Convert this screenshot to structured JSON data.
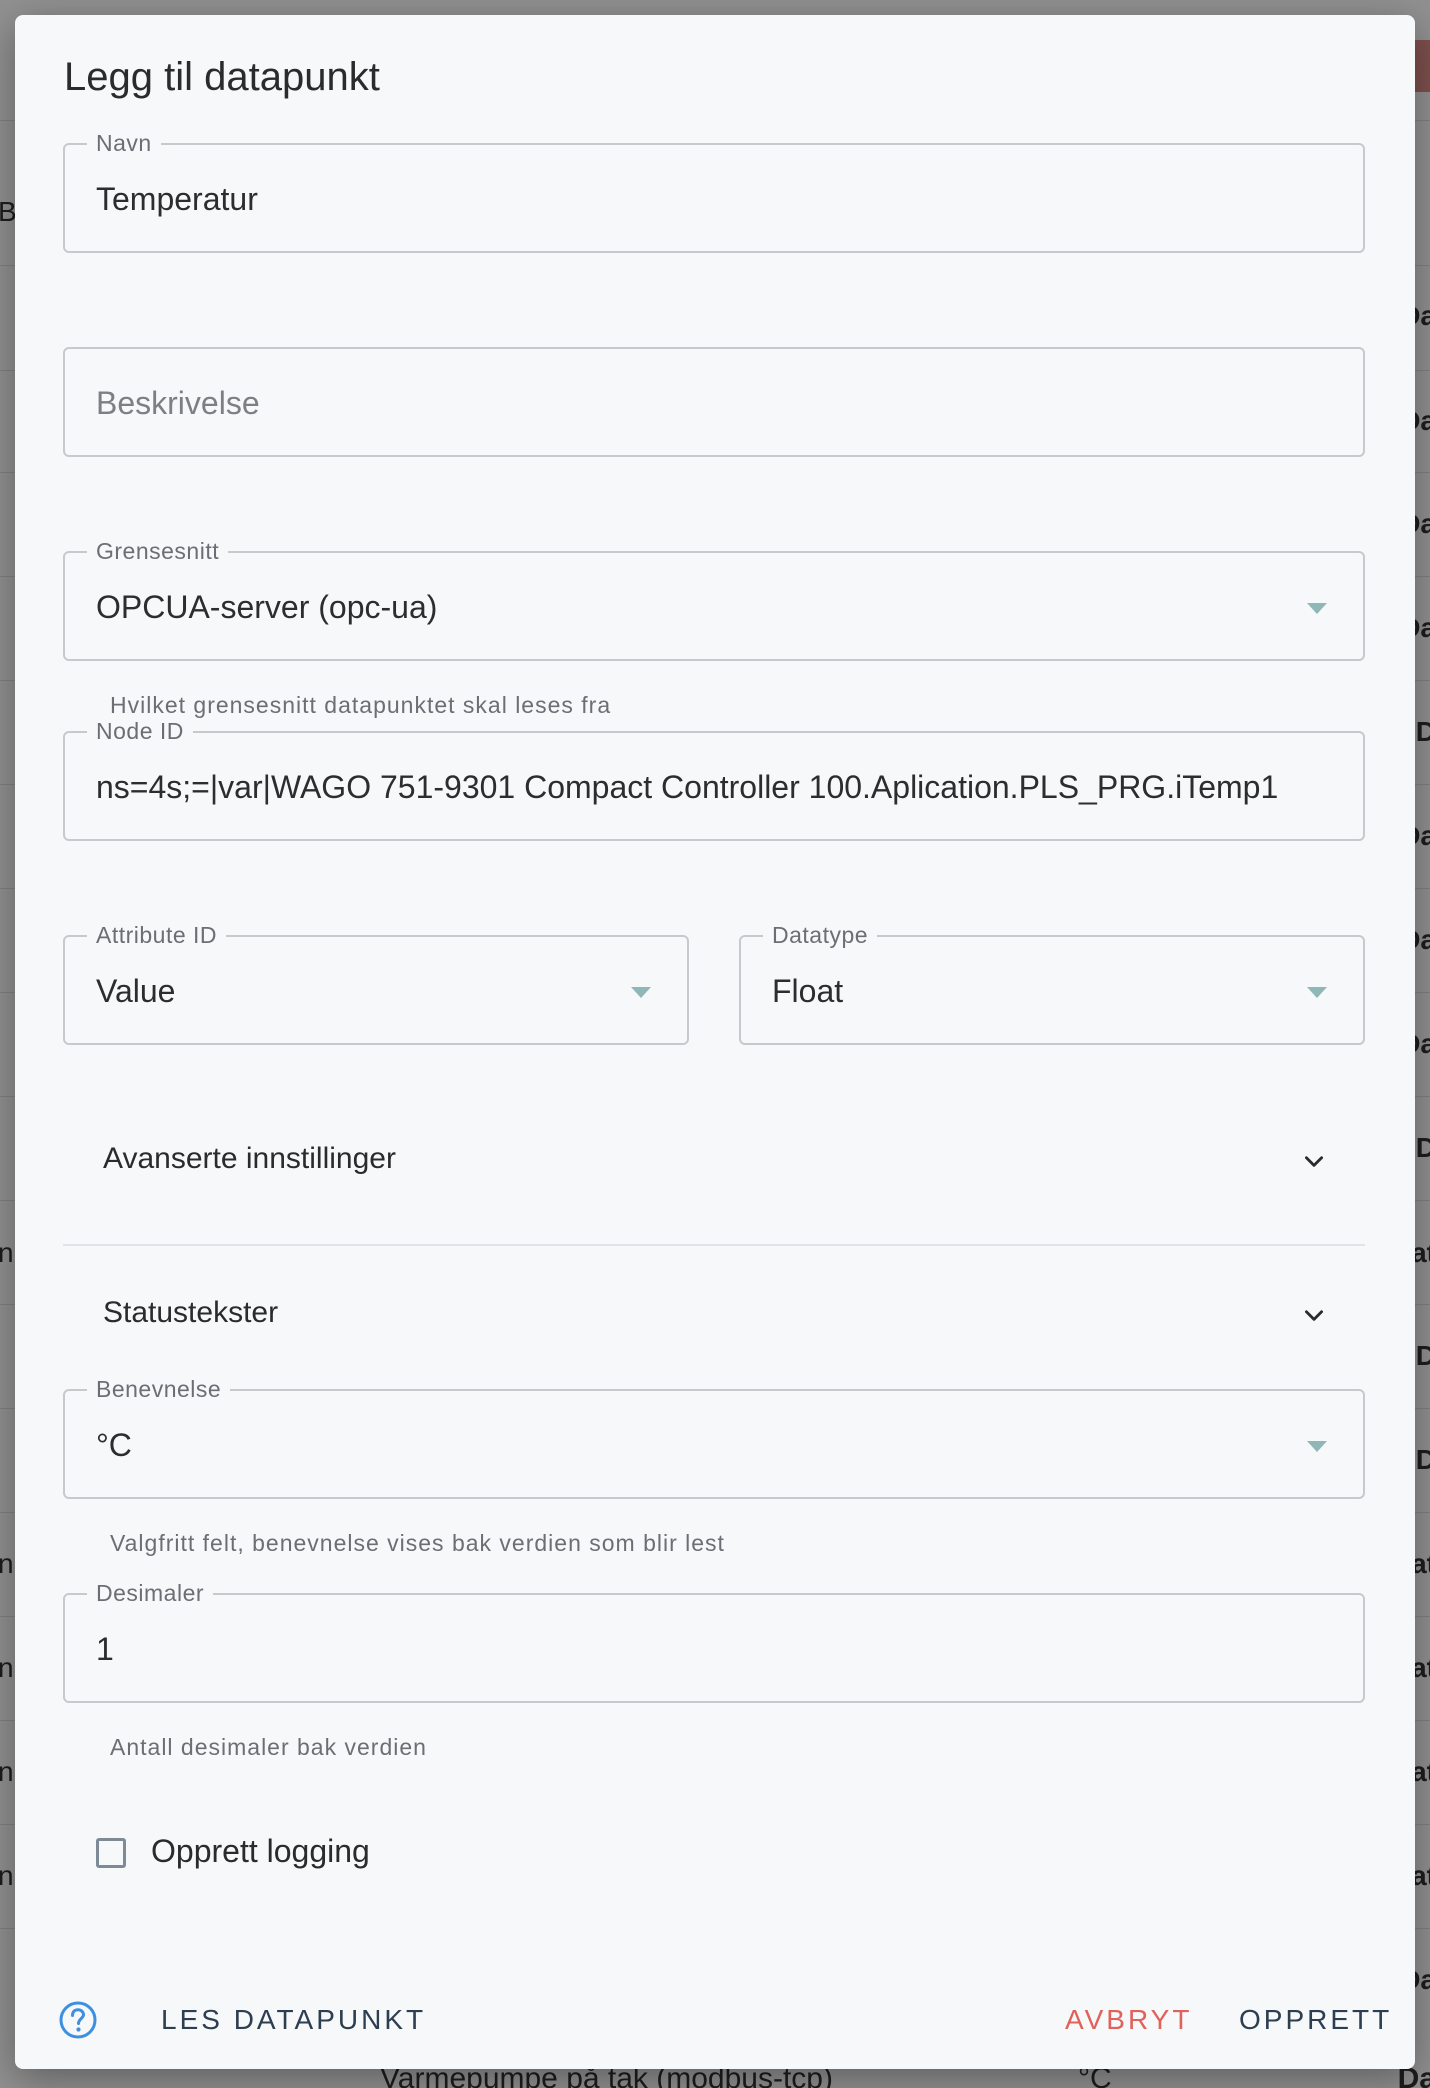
{
  "dialog": {
    "title": "Legg til datapunkt"
  },
  "fields": {
    "navn": {
      "label": "Navn",
      "value": "Temperatur"
    },
    "beskrivelse": {
      "placeholder": "Beskrivelse"
    },
    "grensesnitt": {
      "label": "Grensesnitt",
      "value": "OPCUA-server (opc-ua)",
      "helper": "Hvilket grensesnitt datapunktet skal leses fra"
    },
    "node_id": {
      "label": "Node ID",
      "value": "ns=4s;=|var|WAGO 751-9301 Compact Controller 100.Aplication.PLS_PRG.iTemp1"
    },
    "attribute_id": {
      "label": "Attribute ID",
      "value": "Value"
    },
    "datatype": {
      "label": "Datatype",
      "value": "Float"
    },
    "benevnelse": {
      "label": "Benevnelse",
      "value": "°C",
      "helper": "Valgfritt felt, benevnelse vises bak verdien som blir lest"
    },
    "desimaler": {
      "label": "Desimaler",
      "value": "1",
      "helper": "Antall desimaler bak verdien"
    }
  },
  "sections": {
    "advanced": "Avanserte innstillinger",
    "status_texts": "Statustekster"
  },
  "logging": {
    "label": "Opprett logging",
    "checked": false
  },
  "footer": {
    "read_label": "LES DATAPUNKT",
    "cancel_label": "AVBRYT",
    "create_label": "OPPRETT"
  },
  "background": {
    "left_fragments": [
      "B",
      "nb",
      "nb",
      "nb",
      "nb",
      "nb"
    ],
    "right_fragments": [
      "Da",
      "Da",
      "Da",
      "Da",
      "D",
      "Da",
      "Da",
      "Da",
      "D",
      "at",
      "D",
      "D",
      "at",
      "at",
      "at",
      "at",
      "Da"
    ],
    "bottom_text": "Varmepumpe på tak (modbus-tcp)",
    "bottom_unit": "°C",
    "bottom_right": "Da"
  },
  "colors": {
    "cancel": "#e0625a",
    "primary_text": "#2c3e50",
    "help_icon": "#3d8fe0",
    "dropdown_arrow": "#8fb7b7"
  }
}
